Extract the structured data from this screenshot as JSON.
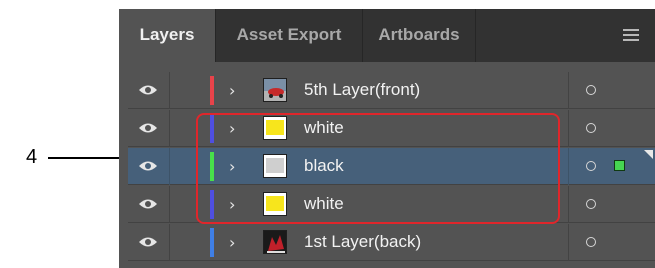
{
  "callout": {
    "number": "4"
  },
  "panel": {
    "tabs": [
      {
        "label": "Layers",
        "active": true
      },
      {
        "label": "Asset Export",
        "active": false
      },
      {
        "label": "Artboards",
        "active": false
      }
    ],
    "menu_icon": "hamburger-menu-icon",
    "layers": [
      {
        "name": "5th Layer(front)",
        "color": "#e8434a",
        "thumbnail": "photo-car",
        "visible": true,
        "selected": false
      },
      {
        "name": "white",
        "color": "#4f4fe0",
        "thumbnail": "yellow",
        "visible": true,
        "selected": false
      },
      {
        "name": "black",
        "color": "#48e04a",
        "thumbnail": "gray",
        "visible": true,
        "selected": true
      },
      {
        "name": "white",
        "color": "#4f4fe0",
        "thumbnail": "yellow",
        "visible": true,
        "selected": false
      },
      {
        "name": "1st Layer(back)",
        "color": "#3f7fe6",
        "thumbnail": "photo-red",
        "visible": true,
        "selected": false
      }
    ]
  },
  "colors": {
    "panel_bg": "#535353",
    "tabbar_bg": "#323232",
    "selected_row": "#46607a",
    "highlight_box": "#e0262b",
    "selection_square": "#46d651"
  }
}
